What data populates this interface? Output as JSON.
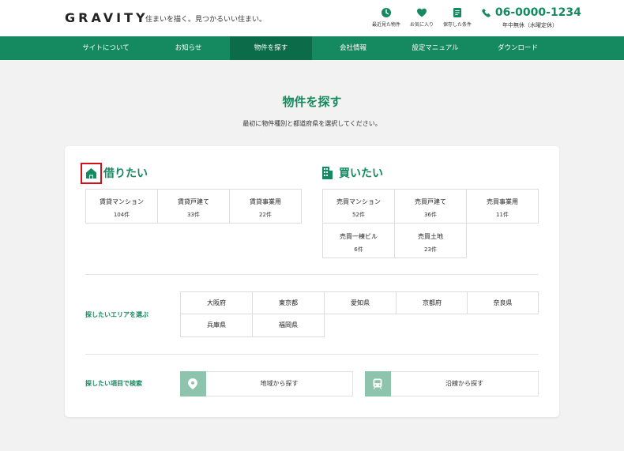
{
  "header": {
    "logo": "GRAVITY",
    "tagline": "住まいを描く。見つかるいい住まい。",
    "icons": [
      {
        "label": "最近見た物件",
        "icon": "clock-icon"
      },
      {
        "label": "お気に入り",
        "icon": "heart-icon"
      },
      {
        "label": "保存した条件",
        "icon": "document-icon"
      }
    ],
    "phone": "06-0000-1234",
    "hours": "年中無休（水曜定休）"
  },
  "nav": {
    "items": [
      {
        "label": "サイトについて"
      },
      {
        "label": "お知らせ"
      },
      {
        "label": "物件を探す",
        "active": true
      },
      {
        "label": "会社情報"
      },
      {
        "label": "設定マニュアル"
      },
      {
        "label": "ダウンロード"
      }
    ]
  },
  "main": {
    "title": "物件を探す",
    "subtitle": "最初に物件種別と都道府県を選択してください。"
  },
  "rent": {
    "title": "借りたい",
    "items": [
      {
        "name": "賃貸マンション",
        "count": "104件"
      },
      {
        "name": "賃貸戸建て",
        "count": "33件"
      },
      {
        "name": "賃貸事業用",
        "count": "22件"
      }
    ]
  },
  "buy": {
    "title": "買いたい",
    "items": [
      {
        "name": "売買マンション",
        "count": "52件"
      },
      {
        "name": "売買戸建て",
        "count": "36件"
      },
      {
        "name": "売買事業用",
        "count": "11件"
      },
      {
        "name": "売買一棟ビル",
        "count": "6件"
      },
      {
        "name": "売買土地",
        "count": "23件"
      }
    ]
  },
  "area": {
    "label": "探したいエリアを選ぶ",
    "items": [
      "大阪府",
      "東京都",
      "愛知県",
      "京都府",
      "奈良県",
      "兵庫県",
      "福岡県"
    ]
  },
  "search": {
    "label": "探したい項目で検索",
    "region": "地域から探す",
    "line": "沿線から探す"
  },
  "colors": {
    "accent": "#15895f",
    "nav_active": "#0c6b49",
    "icon_bg": "#8ec4ad",
    "highlight": "#d0121b"
  }
}
